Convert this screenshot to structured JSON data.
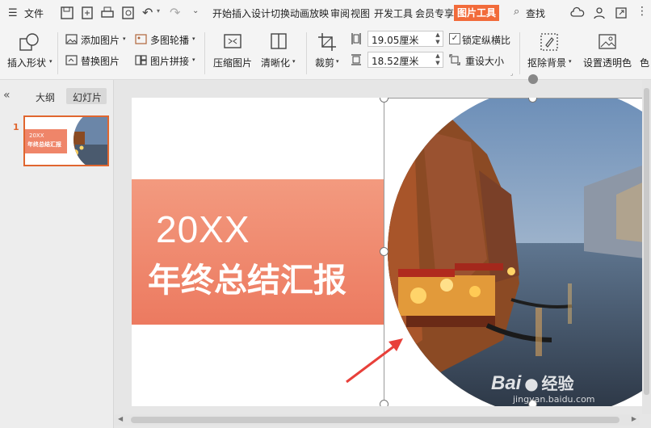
{
  "menu": {
    "file_label": "文件",
    "tabs": [
      "开始",
      "插入",
      "设计",
      "切换",
      "动画",
      "放映",
      "审阅",
      "视图",
      "开发工具",
      "会员专享",
      "图片工具"
    ],
    "search_label": "查找"
  },
  "ribbon": {
    "insert_shape": "插入形状",
    "add_picture": "添加图片",
    "multi_carousel": "多图轮播",
    "replace_picture": "替换图片",
    "picture_stitch": "图片拼接",
    "compress_picture": "压缩图片",
    "sharpen": "清晰化",
    "crop": "裁剪",
    "height_value": "19.05厘米",
    "width_value": "18.52厘米",
    "lock_ratio": "锁定纵横比",
    "reset_size": "重设大小",
    "remove_background": "抠除背景",
    "set_transparent": "设置透明色",
    "color_partial": "色"
  },
  "left_panel": {
    "outline_tab": "大纲",
    "slides_tab": "幻灯片",
    "slide_number": "1",
    "thumb_year": "20XX",
    "thumb_title": "年终总结汇报"
  },
  "slide": {
    "year": "20XX",
    "title": "年终总结汇报"
  },
  "watermark": {
    "brand_a": "Bai",
    "brand_b": "经验",
    "url": "jingyan.baidu.com"
  },
  "colors": {
    "accent": "#f26b3a",
    "band_top": "#f39a7f",
    "band_bottom": "#ec7a60",
    "arrow": "#e8403a"
  }
}
